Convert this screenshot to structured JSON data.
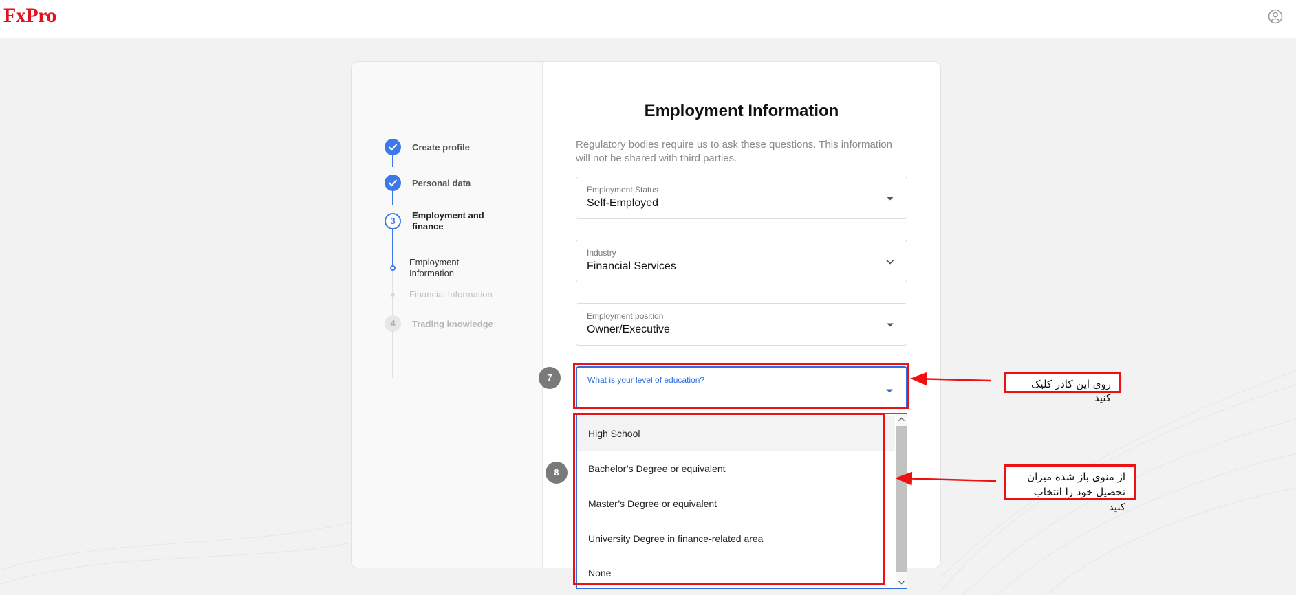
{
  "header": {
    "logo": "FxPro",
    "user_icon": "user-circle-icon"
  },
  "stepper": {
    "steps": [
      {
        "label": "Create profile",
        "status": "done"
      },
      {
        "label": "Personal data",
        "status": "done"
      },
      {
        "number": "3",
        "label": "Employment and finance",
        "status": "active"
      },
      {
        "number": "4",
        "label": "Trading knowledge",
        "status": "todo"
      }
    ],
    "substeps": [
      {
        "label": "Employment Information",
        "status": "active"
      },
      {
        "label": "Financial Information",
        "status": "todo"
      }
    ]
  },
  "form": {
    "title": "Employment Information",
    "description": "Regulatory bodies require us to ask these questions. This information will not be shared with third parties.",
    "fields": [
      {
        "label": "Employment Status",
        "value": "Self-Employed"
      },
      {
        "label": "Industry",
        "value": "Financial Services"
      },
      {
        "label": "Employment position",
        "value": "Owner/Executive"
      },
      {
        "label": "What is your level of education?",
        "value": ""
      }
    ],
    "education_options": [
      "High School",
      "Bachelor’s Degree or equivalent",
      "Master’s Degree or equivalent",
      "University Degree in finance-related area",
      "None"
    ]
  },
  "annotations": {
    "badge_7": "7",
    "badge_8": "8",
    "callout_1": "روی این کادر کلیک کنید",
    "callout_2_line1": "از منوی باز شده میزان",
    "callout_2_line2": "تحصیل خود را انتخاب کنید"
  },
  "colors": {
    "brand": "#e3101f",
    "accent": "#3b7ae8",
    "annotation": "#e11111"
  }
}
